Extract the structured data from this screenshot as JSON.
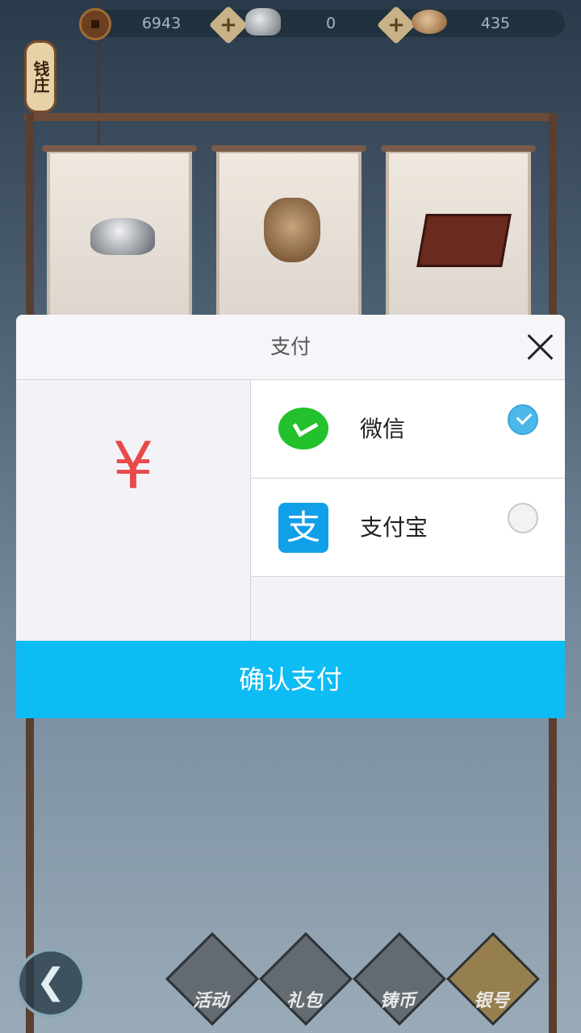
{
  "topbar": {
    "copper": "6943",
    "silver": "0",
    "shells": "435",
    "plus": "+"
  },
  "header": {
    "title": "钱庄"
  },
  "nav": {
    "back": "❮",
    "items": [
      "活动",
      "礼包",
      "铸币",
      "银号"
    ]
  },
  "dialog": {
    "title": "支付",
    "currency_symbol": "¥",
    "options": [
      {
        "label": "微信",
        "selected": true
      },
      {
        "label": "支付宝",
        "selected": false
      }
    ],
    "alipay_glyph": "支",
    "confirm_label": "确认支付"
  },
  "colors": {
    "confirm": "#0ebcf4",
    "wechat": "#23c12b",
    "alipay": "#11a0e8",
    "yen": "#e84a4a"
  },
  "icons": [
    "copper-coin-icon",
    "silver-ingot-icon",
    "shell-icon",
    "close-icon",
    "wechat-icon",
    "alipay-icon",
    "check-icon",
    "back-icon"
  ]
}
